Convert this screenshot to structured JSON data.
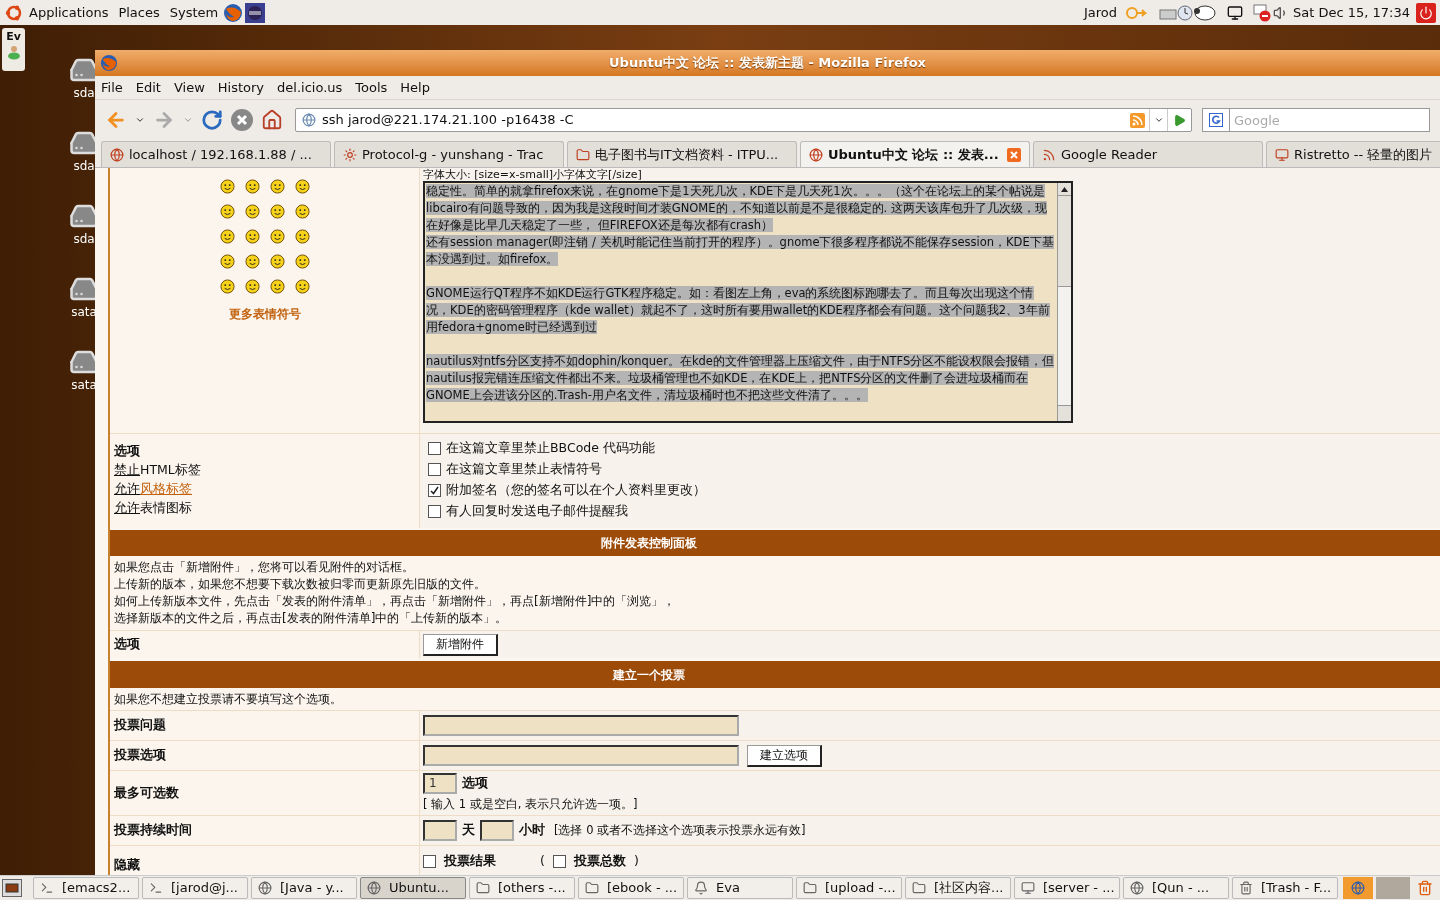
{
  "panel": {
    "menus": [
      "Applications",
      "Places",
      "System"
    ],
    "user": "Jarod",
    "clock": "Sat Dec 15, 17:34"
  },
  "desktop": {
    "widget_label": "Ev",
    "icons": [
      "sda",
      "sda",
      "sda",
      "sata",
      "sata"
    ]
  },
  "window": {
    "title": "Ubuntu中文 论坛 :: 发表新主题 - Mozilla Firefox"
  },
  "menu": [
    "File",
    "Edit",
    "View",
    "History",
    "del.icio.us",
    "Tools",
    "Help"
  ],
  "address": {
    "value": "ssh jarod@221.174.21.100 -p16438 -C"
  },
  "search": {
    "placeholder": "Google"
  },
  "tabs": [
    {
      "label": "localhost / 192.168.1.88 / ...",
      "selected": false
    },
    {
      "label": "Protocol-g - yunshang - Trac",
      "selected": false
    },
    {
      "label": "电子图书与IT文档资料 - ITPU...",
      "selected": false
    },
    {
      "label": "Ubuntu中文 论坛 :: 发表...",
      "selected": true
    },
    {
      "label": "Google Reader",
      "selected": false
    },
    {
      "label": "Ristretto -- 轻量的图片",
      "selected": false
    }
  ],
  "editor": {
    "more_smilies": "更多表情符号",
    "hint": "字体大小: [size=x-small]小字体文字[/size]",
    "selected": true,
    "blocks": [
      {
        "lines": [
          "稳定性。简单的就拿firefox来说，在gnome下是1天死几次，KDE下是几天死1次。。。（这个在论坛上的某个帖说是libcairo有问题导致的，因为我是这段时间才装GNOME的，不知道以前是不是很稳定的. 这两天该库包升了几次级，现在好像是比早几天稳定了一些， 但FIREFOX还是每次都有crash）",
          "还有session manager(即注销 / 关机时能记住当前打开的程序）。gnome下很多程序都说不能保存session，KDE下基本没遇到过。如firefox。"
        ]
      },
      {
        "lines": [
          "GNOME运行QT程序不如KDE运行GTK程序稳定。如：看图左上角，eva的系统图标跑哪去了。而且每次出现这个情况，KDE的密码管理程序（kde wallet）就起不了，这时所有要用wallet的KDE程序都会有问题。这个问题我2、3年前用fedora+gnome时已经遇到过"
        ]
      },
      {
        "lines": [
          "nautilus对ntfs分区支持不如dophin/konquer。在kde的文件管理器上压缩文件，由于NTFS分区不能设权限会报错，但nautilus报完错连压缩文件都出不来。垃圾桶管理也不如KDE，在KDE上，把NTFS分区的文件删了会进垃圾桶而在GNOME上会进该分区的.Trash-用户名文件，清垃圾桶时也不把这些文件清了。。。"
        ]
      }
    ]
  },
  "options": {
    "title": "选项",
    "rules": [
      {
        "state": "禁止",
        "label": "HTML标签",
        "link": false
      },
      {
        "state": "允许",
        "label": "风格标签",
        "link": true
      },
      {
        "state": "允许",
        "label": "表情图标",
        "link": false
      }
    ],
    "checkboxes": [
      {
        "label": "在这篇文章里禁止BBCode 代码功能",
        "checked": false
      },
      {
        "label": "在这篇文章里禁止表情符号",
        "checked": false
      },
      {
        "label": "附加签名（您的签名可以在个人资料里更改）",
        "checked": true
      },
      {
        "label": "有人回复时发送电子邮件提醒我",
        "checked": false
      }
    ]
  },
  "attachments": {
    "header": "附件发表控制面板",
    "lines": [
      "如果您点击「新增附件」，您将可以看见附件的对话框。",
      "上传新的版本，如果您不想要下载次数被归零而更新原先旧版的文件。",
      "如何上传新版本文件，先点击「发表的附件清单」，再点击「新增附件」，再点[新增附件]中的「浏览」，",
      "选择新版本的文件之后，再点击[发表的附件清单]中的「上传新的版本」。"
    ],
    "label": "选项",
    "button": "新增附件"
  },
  "poll": {
    "header": "建立一个投票",
    "note": "如果您不想建立投票请不要填写这个选项。",
    "rows": [
      {
        "kind": "text",
        "label": "投票问题"
      },
      {
        "kind": "text_button",
        "label": "投票选项",
        "button": "建立选项"
      },
      {
        "kind": "max",
        "label": "最多可选数",
        "value": "1",
        "unit": "选项",
        "hint": "[ 输入 1 或是空白, 表示只允许选一项。]"
      },
      {
        "kind": "duration",
        "label": "投票持续时间",
        "day": "天",
        "hour": "小时",
        "hint": "[选择 0 或者不选择这个选项表示投票永远有效]"
      },
      {
        "kind": "hide",
        "label": "隐藏",
        "open": "(",
        "close": ")",
        "options": [
          {
            "label": "投票结果",
            "checked": false
          },
          {
            "label": "投票总数",
            "checked": false
          }
        ]
      }
    ]
  },
  "taskbar": [
    {
      "label": "[emacs2...",
      "selected": false
    },
    {
      "label": "[jarod@j...",
      "selected": false
    },
    {
      "label": "[Java - y...",
      "selected": false
    },
    {
      "label": "Ubuntu...",
      "selected": true
    },
    {
      "label": "[others -...",
      "selected": false
    },
    {
      "label": "[ebook - ...",
      "selected": false
    },
    {
      "label": "Eva",
      "selected": false
    },
    {
      "label": "[upload -...",
      "selected": false
    },
    {
      "label": "[社区内容...",
      "selected": false
    },
    {
      "label": "[server - ...",
      "selected": false
    },
    {
      "label": "[Qun - ...",
      "selected": false
    },
    {
      "label": "[Trash - F...",
      "selected": false
    }
  ]
}
